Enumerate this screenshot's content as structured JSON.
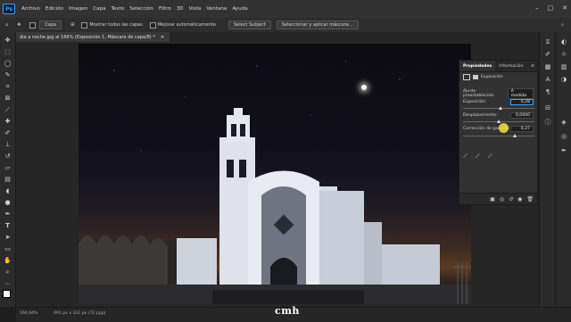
{
  "app": {
    "logo": "Ps"
  },
  "menu": [
    "Archivo",
    "Edición",
    "Imagen",
    "Capa",
    "Texto",
    "Selección",
    "Filtro",
    "3D",
    "Vista",
    "Ventana",
    "Ayuda"
  ],
  "options": {
    "auto_select_label": "Capa",
    "show_all_layers": "Mostrar todas las capas",
    "improve_auto": "Mejorar automáticamente",
    "select_subject": "Select Subject",
    "select_mask": "Seleccionar y aplicar máscara..."
  },
  "document": {
    "tab_title": "dia a noche.jpg al 166% (Exposición 1, Máscara de capa/8) *",
    "zoom": "166,94%",
    "info": "491 px x 331 px (72 ppp)"
  },
  "properties": {
    "tabs": [
      "Propiedades",
      "Información"
    ],
    "adjustment_name": "Exposición",
    "preset_label": "Ajuste preestablecido:",
    "preset_value": "A medida",
    "exposure_label": "Exposición:",
    "exposure_value": "0,28",
    "exposure_fraction": 0.53,
    "offset_label": "Desplazamiento:",
    "offset_value": "0,0000",
    "offset_fraction": 0.5,
    "gamma_label": "Corrección de gamma:",
    "gamma_value": "0,37",
    "gamma_fraction": 0.72
  },
  "watermark": "cmh",
  "colors": {
    "accent": "#31a8ff",
    "cursor": "#f2e33a"
  }
}
